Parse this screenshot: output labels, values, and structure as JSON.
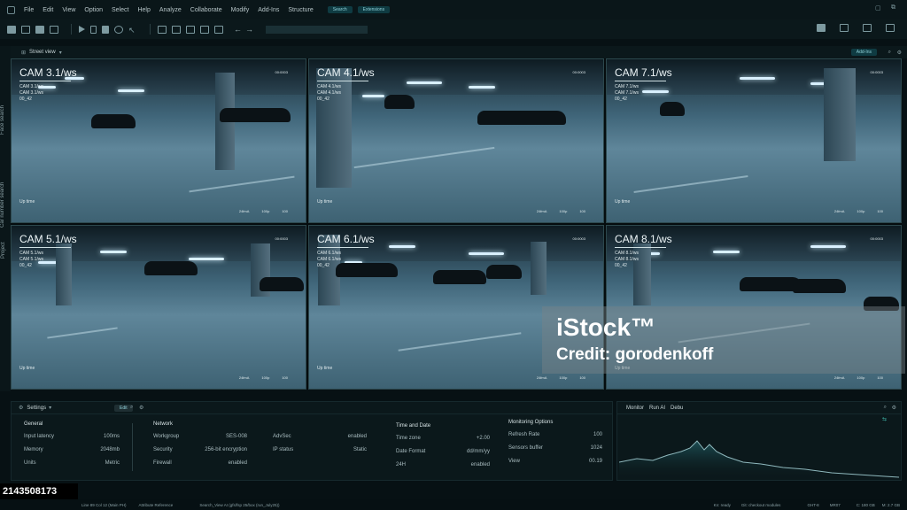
{
  "menu": [
    "File",
    "Edit",
    "View",
    "Option",
    "Select",
    "Help",
    "Analyze",
    "Collaborate",
    "Modify",
    "Add-Ins",
    "Structure"
  ],
  "menu_pills": {
    "search": "Search",
    "extensions": "Extensions"
  },
  "sidebar_tabs": [
    "Face search",
    "Car number search",
    "Project"
  ],
  "view": {
    "title": "Street view",
    "addins": "Add-Ins"
  },
  "cameras": [
    {
      "title": "CAM 3.1/ws",
      "line1": "CAM 3.1/ws",
      "line2": "00_42",
      "code": "00:0003",
      "uptime": "Up time",
      "stats": [
        "24fmA",
        "100p",
        "100"
      ]
    },
    {
      "title": "CAM 4.1/ws",
      "line1": "CAM 4.1/ws",
      "line2": "00_42",
      "code": "00:0003",
      "uptime": "Up time",
      "stats": [
        "24fmA",
        "100p",
        "100"
      ]
    },
    {
      "title": "CAM 7.1/ws",
      "line1": "CAM 7.1/ws",
      "line2": "00_42",
      "code": "00:0003",
      "uptime": "Up time",
      "stats": [
        "24fmA",
        "100p",
        "100"
      ]
    },
    {
      "title": "CAM 5.1/ws",
      "line1": "CAM 5.1/ws",
      "line2": "00_42",
      "code": "00:0003",
      "uptime": "Up time",
      "stats": [
        "24fmA",
        "100p",
        "100"
      ]
    },
    {
      "title": "CAM 6.1/ws",
      "line1": "CAM 6.1/ws",
      "line2": "00_42",
      "code": "00:0003",
      "uptime": "Up time",
      "stats": [
        "24fmA",
        "100p",
        "100"
      ]
    },
    {
      "title": "CAM 8.1/ws",
      "line1": "CAM 8.1/ws",
      "line2": "00_42",
      "code": "00:0003",
      "uptime": "Up time",
      "stats": [
        "24fmA",
        "100p",
        "100"
      ]
    }
  ],
  "watermark": {
    "brand": "iStock™",
    "credit": "Credit: gorodenkoff"
  },
  "settings": {
    "title": "Settings",
    "edit": "Edit",
    "general": {
      "title": "General",
      "rows": [
        [
          "Input latency",
          "100ms"
        ],
        [
          "Memory",
          "2048mb"
        ],
        [
          "Units",
          "Metric"
        ]
      ]
    },
    "network": {
      "title": "Network",
      "rows": [
        [
          "Workgroup",
          "SES-008"
        ],
        [
          "Security",
          "256-bit encryption"
        ],
        [
          "Firewall",
          "enabled"
        ]
      ]
    },
    "network2": {
      "rows": [
        [
          "AdvSec",
          "enabled"
        ],
        [
          "IP status",
          "Static"
        ]
      ]
    },
    "time": {
      "title": "Time and Date",
      "rows": [
        [
          "Time zone",
          "+2.00"
        ],
        [
          "Date Format",
          "dd/mm/yy"
        ],
        [
          "24H",
          "enabled"
        ]
      ]
    },
    "monitoring": {
      "title": "Monitoring Options",
      "rows": [
        [
          "Refresh Rate",
          "100"
        ],
        [
          "Sensors buffer",
          "1024"
        ],
        [
          "View",
          "00.19"
        ]
      ]
    }
  },
  "monitor": {
    "tabs": [
      "Monitor",
      "Run AI",
      "Debu"
    ]
  },
  "statusbar": {
    "left": "Line 89 Col 12 (Main PH)",
    "attr": "Attribute Reference",
    "path": "Search_View AI (gfs/fsp 25/box (run_July25))",
    "kn": "Kn: ready",
    "git": "Git: checkout modules",
    "ght": "GHT-8",
    "mr": "MR07",
    "c": "C: 180 GB",
    "m": "M: 2.7 GB"
  },
  "stock_id": "2143508173"
}
